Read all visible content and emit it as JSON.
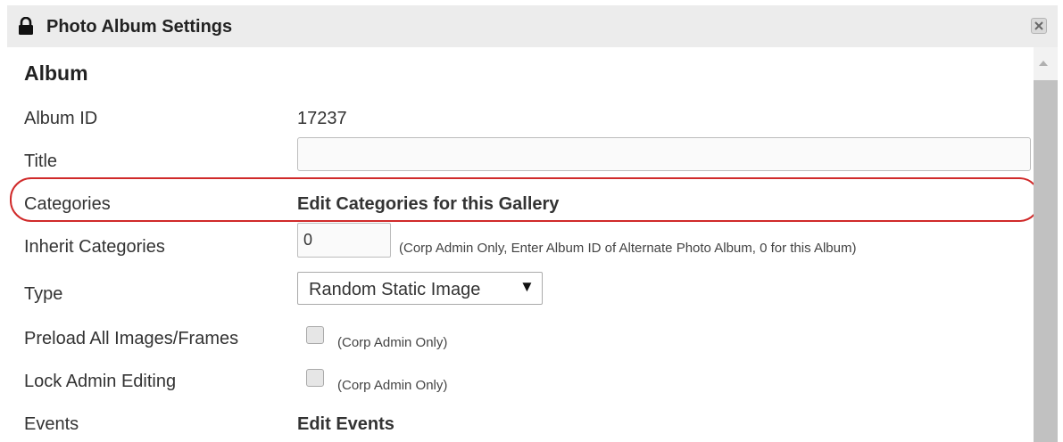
{
  "window": {
    "title": "Photo Album Settings",
    "lock_icon": "lock-icon",
    "close_icon": "close-icon"
  },
  "section": {
    "heading": "Album"
  },
  "fields": {
    "album_id": {
      "label": "Album ID",
      "value": "17237"
    },
    "title": {
      "label": "Title",
      "value": ""
    },
    "categories": {
      "label": "Categories",
      "link": "Edit Categories for this Gallery"
    },
    "inherit_categories": {
      "label": "Inherit Categories",
      "value": "0",
      "hint": "(Corp Admin Only, Enter Album ID of Alternate Photo Album, 0 for this Album)"
    },
    "type": {
      "label": "Type",
      "selected": "Random Static Image"
    },
    "preload": {
      "label": "Preload All Images/Frames",
      "checked": false,
      "hint": "(Corp Admin Only)"
    },
    "lock_admin": {
      "label": "Lock Admin Editing",
      "checked": false,
      "hint": "(Corp Admin Only)"
    },
    "events": {
      "label": "Events",
      "link": "Edit Events"
    }
  },
  "colors": {
    "highlight": "#d02a2a",
    "titlebar": "#ececec",
    "scroll_thumb": "#c1c1c1"
  }
}
